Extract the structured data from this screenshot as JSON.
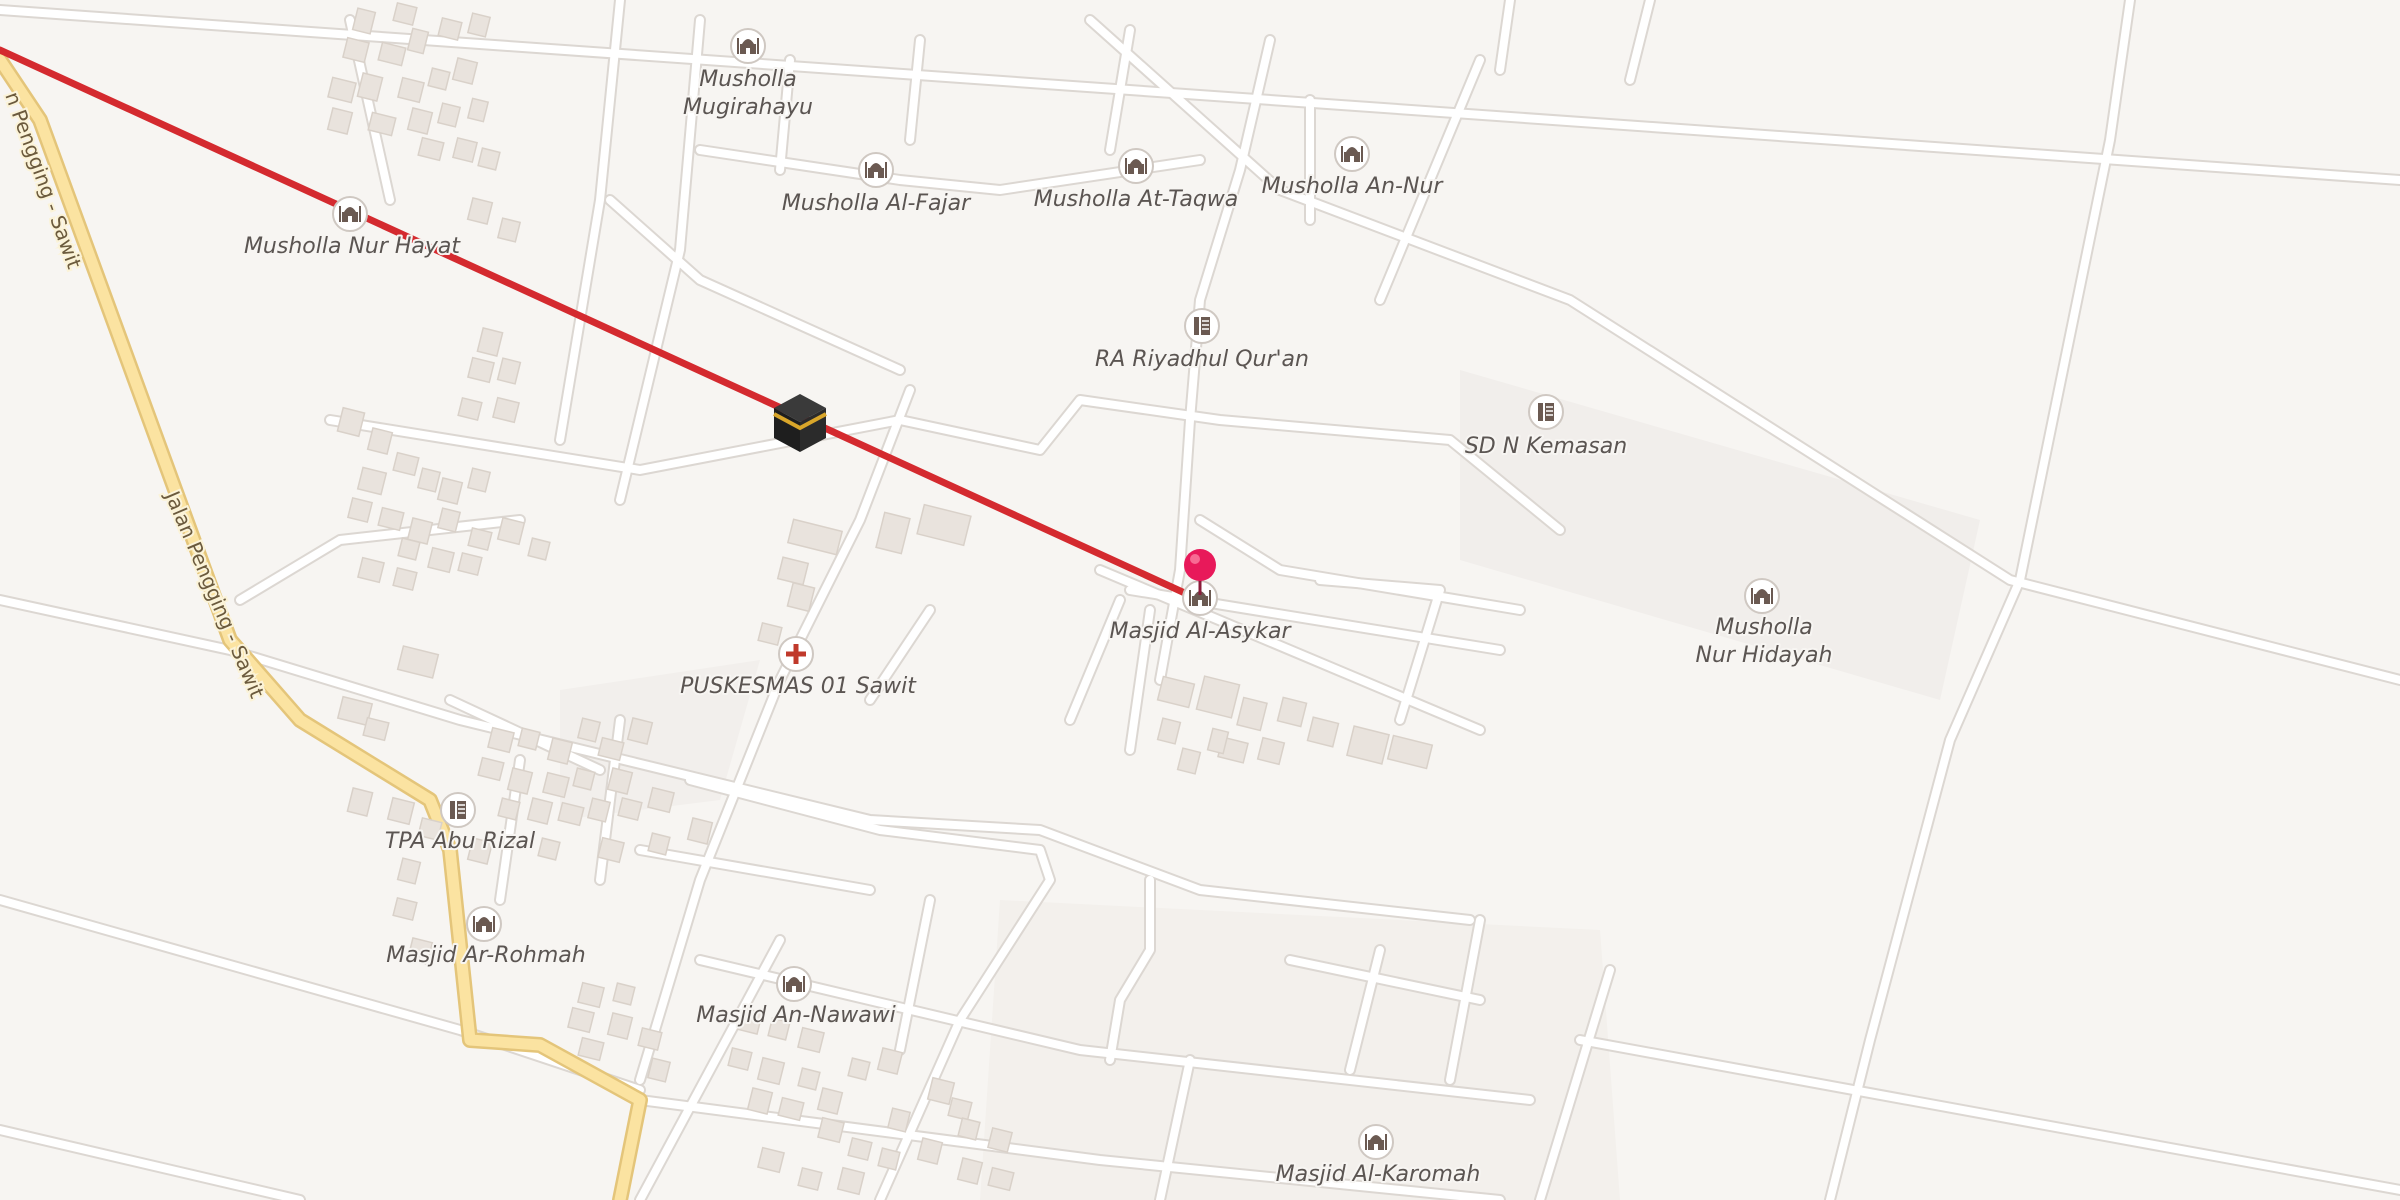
{
  "map": {
    "road_name": "Jalan Pengging - Sawit",
    "road_name_partial": "n Pengging - Sawit",
    "selected_place": "Masjid Al-Asykar",
    "pois": [
      {
        "id": "musholla-mugirahayu",
        "lines": [
          "Musholla",
          "Mugirahayu"
        ],
        "icon": "mosque-icon"
      },
      {
        "id": "musholla-al-fajar",
        "lines": [
          "Musholla Al-Fajar"
        ],
        "icon": "mosque-icon"
      },
      {
        "id": "musholla-at-taqwa",
        "lines": [
          "Musholla At-Taqwa"
        ],
        "icon": "mosque-icon"
      },
      {
        "id": "musholla-an-nur",
        "lines": [
          "Musholla An-Nur"
        ],
        "icon": "mosque-icon"
      },
      {
        "id": "musholla-nur-hayat",
        "lines": [
          "Musholla Nur Hayat"
        ],
        "icon": "mosque-icon"
      },
      {
        "id": "ra-riyadhul-quran",
        "lines": [
          "RA Riyadhul Qur'an"
        ],
        "icon": "school-icon"
      },
      {
        "id": "sd-n-kemasan",
        "lines": [
          "SD N Kemasan"
        ],
        "icon": "school-icon"
      },
      {
        "id": "masjid-al-asykar",
        "lines": [
          "Masjid Al-Asykar"
        ],
        "icon": "mosque-icon"
      },
      {
        "id": "musholla-nur-hidayah",
        "lines": [
          "Musholla",
          "Nur Hidayah"
        ],
        "icon": "mosque-icon"
      },
      {
        "id": "puskesmas-01-sawit",
        "lines": [
          "PUSKESMAS 01 Sawit"
        ],
        "icon": "health-cross-icon"
      },
      {
        "id": "tpa-abu-rizal",
        "lines": [
          "TPA Abu Rizal"
        ],
        "icon": "school-icon"
      },
      {
        "id": "masjid-ar-rohmah",
        "lines": [
          "Masjid Ar-Rohmah"
        ],
        "icon": "mosque-icon"
      },
      {
        "id": "masjid-an-nawawi",
        "lines": [
          "Masjid An-Nawawi"
        ],
        "icon": "mosque-icon"
      },
      {
        "id": "masjid-al-karomah",
        "lines": [
          "Masjid Al-Karomah"
        ],
        "icon": "mosque-icon"
      }
    ],
    "markers": {
      "pin": {
        "name": "location-pin-icon",
        "color": "#e8195a"
      },
      "kaaba": {
        "name": "kaaba-icon"
      }
    },
    "qibla_line_color": "#d42a2f",
    "colors": {
      "background": "#f7f5f2",
      "road": "#ffffff",
      "road_casing": "#dcd7d2",
      "main_road": "#fbe3a1",
      "main_road_casing": "#e4c57a",
      "building": "#e9e3dd",
      "building_edge": "#d9d1c9",
      "icon": "#6b5a52"
    }
  }
}
